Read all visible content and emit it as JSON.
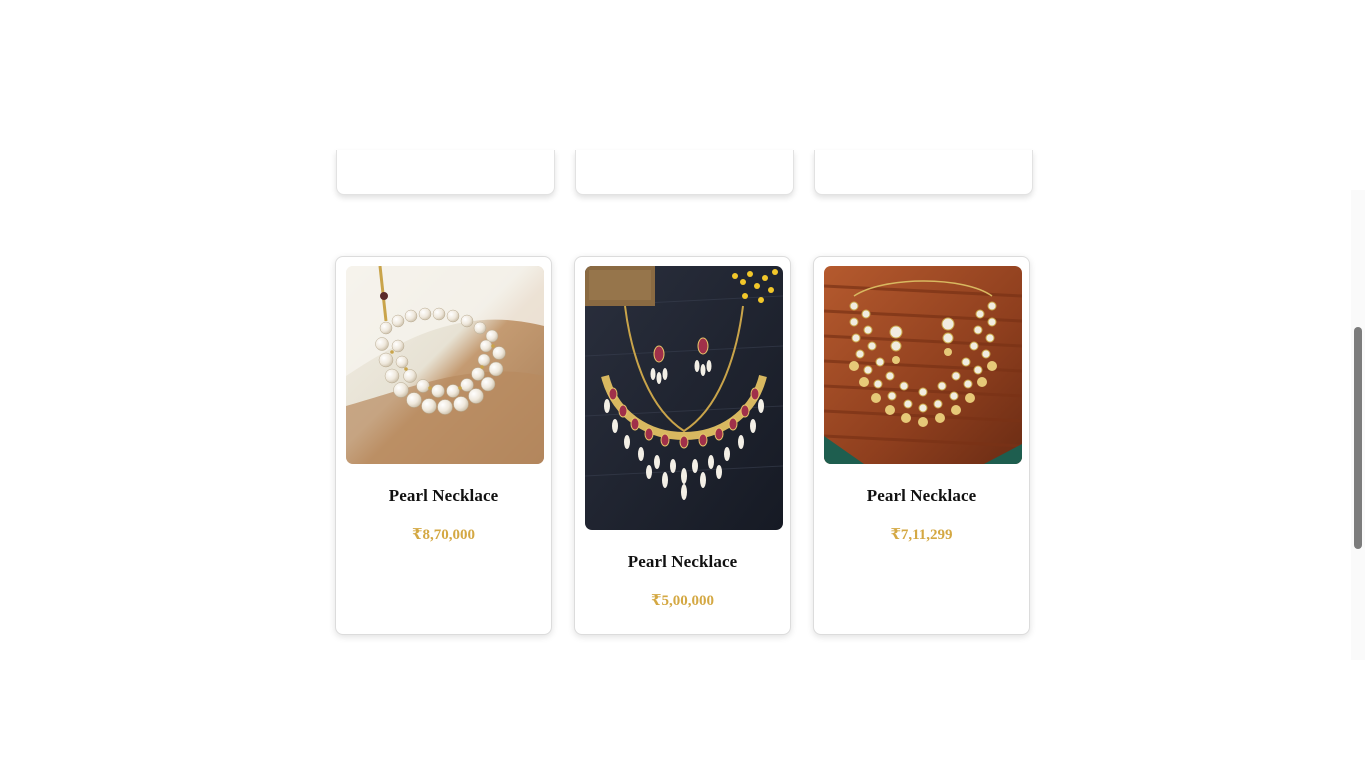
{
  "products": [
    {
      "name": "Pearl Necklace",
      "price": "₹8,70,000",
      "image_icon": "pearl-choker-necklace-photo"
    },
    {
      "name": "Pearl Necklace",
      "price": "₹5,00,000",
      "image_icon": "ruby-pearl-necklace-set-photo"
    },
    {
      "name": "Pearl Necklace",
      "price": "₹7,11,299",
      "image_icon": "kundan-pearl-necklace-set-photo"
    }
  ],
  "colors": {
    "price": "#d4a843",
    "name": "#111111",
    "card_border": "#dcdcdc"
  }
}
